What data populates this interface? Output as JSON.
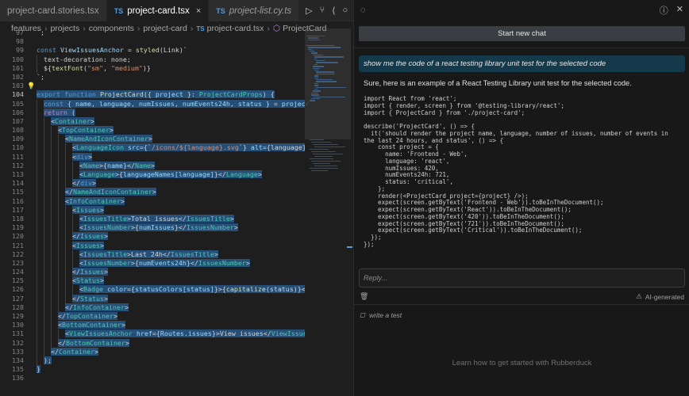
{
  "tabs": [
    {
      "label": "project-card.stories.tsx",
      "prefix": "",
      "active": false,
      "italic": false,
      "close": ""
    },
    {
      "label": "project-card.tsx",
      "prefix": "TS",
      "active": true,
      "italic": false,
      "close": "×"
    },
    {
      "label": "project-list.cy.ts",
      "prefix": "TS",
      "active": false,
      "italic": true,
      "close": ""
    }
  ],
  "breadcrumb": [
    {
      "label": "features",
      "icon": ""
    },
    {
      "label": "projects",
      "icon": ""
    },
    {
      "label": "components",
      "icon": ""
    },
    {
      "label": "project-card",
      "icon": ""
    },
    {
      "label": "project-card.tsx",
      "icon": "TS"
    },
    {
      "label": "ProjectCard",
      "icon": "symbol"
    }
  ],
  "editor_actions": [
    {
      "name": "run-icon",
      "glyph": "▷"
    },
    {
      "name": "source-control-icon",
      "glyph": "⑂"
    },
    {
      "name": "go-back-icon",
      "glyph": "⟨"
    },
    {
      "name": "circle-icon",
      "glyph": "○"
    },
    {
      "name": "go-forward-icon",
      "glyph": "⟩"
    },
    {
      "name": "github-icon",
      "glyph": "◉"
    },
    {
      "name": "split-editor-icon",
      "glyph": "▯"
    },
    {
      "name": "more-icon",
      "glyph": "…"
    }
  ],
  "code_lines": [
    {
      "n": "97",
      "indent": 0,
      "sel": false,
      "tokens": [
        [
          "pl",
          "`;"
        ]
      ]
    },
    {
      "n": "98",
      "indent": 0,
      "sel": false,
      "tokens": []
    },
    {
      "n": "99",
      "indent": 0,
      "sel": false,
      "tokens": [
        [
          "kw",
          "const "
        ],
        [
          "var",
          "ViewIssuesAnchor"
        ],
        [
          "pl",
          " = "
        ],
        [
          "fn",
          "styled"
        ],
        [
          "pl",
          "(Link)`"
        ]
      ]
    },
    {
      "n": "100",
      "indent": 1,
      "sel": false,
      "tokens": [
        [
          "pl",
          "text-decoration: none;"
        ]
      ]
    },
    {
      "n": "101",
      "indent": 1,
      "sel": false,
      "tokens": [
        [
          "pl",
          "${"
        ],
        [
          "fn",
          "textFont"
        ],
        [
          "pl",
          "("
        ],
        [
          "str",
          "\"sm\""
        ],
        [
          "pl",
          ", "
        ],
        [
          "str",
          "\"medium\""
        ],
        [
          "pl",
          ")}"
        ]
      ]
    },
    {
      "n": "102",
      "indent": 0,
      "sel": false,
      "tokens": [
        [
          "pl",
          "`;"
        ]
      ]
    },
    {
      "n": "103",
      "indent": 0,
      "sel": false,
      "bulb": "💡",
      "tokens": []
    },
    {
      "n": "104",
      "indent": 0,
      "sel": true,
      "cur": true,
      "tokens": [
        [
          "kw",
          "export "
        ],
        [
          "kw",
          "function "
        ],
        [
          "fn",
          "ProjectCard"
        ],
        [
          "pl",
          "({ "
        ],
        [
          "var",
          "project"
        ],
        [
          "pl",
          " }: "
        ],
        [
          "tag",
          "ProjectCardProps"
        ],
        [
          "pl",
          ") {"
        ]
      ]
    },
    {
      "n": "105",
      "indent": 1,
      "sel": true,
      "tokens": [
        [
          "kw",
          "const "
        ],
        [
          "pl",
          "{ "
        ],
        [
          "var",
          "name"
        ],
        [
          "pl",
          ", "
        ],
        [
          "var",
          "language"
        ],
        [
          "pl",
          ", "
        ],
        [
          "var",
          "numIssues"
        ],
        [
          "pl",
          ", "
        ],
        [
          "var",
          "numEvents24h"
        ],
        [
          "pl",
          ", "
        ],
        [
          "var",
          "status"
        ],
        [
          "pl",
          " } = "
        ],
        [
          "var",
          "project"
        ],
        [
          "pl",
          ";"
        ]
      ]
    },
    {
      "n": "106",
      "indent": 1,
      "sel": true,
      "tokens": [
        [
          "kw2",
          "return "
        ],
        [
          "pl",
          "("
        ]
      ]
    },
    {
      "n": "107",
      "indent": 2,
      "sel": true,
      "tokens": [
        [
          "pl",
          "<"
        ],
        [
          "tag",
          "Container"
        ],
        [
          "pl",
          ">"
        ]
      ]
    },
    {
      "n": "108",
      "indent": 3,
      "sel": true,
      "tokens": [
        [
          "pl",
          "<"
        ],
        [
          "tag",
          "TopContainer"
        ],
        [
          "pl",
          ">"
        ]
      ]
    },
    {
      "n": "109",
      "indent": 4,
      "sel": true,
      "tokens": [
        [
          "pl",
          "<"
        ],
        [
          "tag",
          "NameAndIconContainer"
        ],
        [
          "pl",
          ">"
        ]
      ]
    },
    {
      "n": "110",
      "indent": 5,
      "sel": true,
      "tokens": [
        [
          "pl",
          "<"
        ],
        [
          "tag",
          "LanguageIcon"
        ],
        [
          "attr",
          " src"
        ],
        [
          "pl",
          "={`"
        ],
        [
          "str",
          "/icons/${language}.svg"
        ],
        [
          "pl",
          "`} "
        ],
        [
          "attr",
          "alt"
        ],
        [
          "pl",
          "={language} />"
        ]
      ]
    },
    {
      "n": "111",
      "indent": 5,
      "sel": true,
      "tokens": [
        [
          "pl",
          "<"
        ],
        [
          "kw",
          "div"
        ],
        [
          "pl",
          ">"
        ]
      ]
    },
    {
      "n": "112",
      "indent": 6,
      "sel": true,
      "tokens": [
        [
          "pl",
          "<"
        ],
        [
          "tag",
          "Name"
        ],
        [
          "pl",
          ">{"
        ],
        [
          "var",
          "name"
        ],
        [
          "pl",
          "}</"
        ],
        [
          "tag",
          "Name"
        ],
        [
          "pl",
          ">"
        ]
      ]
    },
    {
      "n": "113",
      "indent": 6,
      "sel": true,
      "tokens": [
        [
          "pl",
          "<"
        ],
        [
          "tag",
          "Language"
        ],
        [
          "pl",
          ">{"
        ],
        [
          "var",
          "languageNames[language]"
        ],
        [
          "pl",
          "}</"
        ],
        [
          "tag",
          "Language"
        ],
        [
          "pl",
          ">"
        ]
      ]
    },
    {
      "n": "114",
      "indent": 5,
      "sel": true,
      "tokens": [
        [
          "pl",
          "</"
        ],
        [
          "kw",
          "div"
        ],
        [
          "pl",
          ">"
        ]
      ]
    },
    {
      "n": "115",
      "indent": 4,
      "sel": true,
      "tokens": [
        [
          "pl",
          "</"
        ],
        [
          "tag",
          "NameAndIconContainer"
        ],
        [
          "pl",
          ">"
        ]
      ]
    },
    {
      "n": "116",
      "indent": 4,
      "sel": true,
      "tokens": [
        [
          "pl",
          "<"
        ],
        [
          "tag",
          "InfoContainer"
        ],
        [
          "pl",
          ">"
        ]
      ]
    },
    {
      "n": "117",
      "indent": 5,
      "sel": true,
      "tokens": [
        [
          "pl",
          "<"
        ],
        [
          "tag",
          "Issues"
        ],
        [
          "pl",
          ">"
        ]
      ]
    },
    {
      "n": "118",
      "indent": 6,
      "sel": true,
      "tokens": [
        [
          "pl",
          "<"
        ],
        [
          "tag",
          "IssuesTitle"
        ],
        [
          "pl",
          ">Total issues</"
        ],
        [
          "tag",
          "IssuesTitle"
        ],
        [
          "pl",
          ">"
        ]
      ]
    },
    {
      "n": "119",
      "indent": 6,
      "sel": true,
      "tokens": [
        [
          "pl",
          "<"
        ],
        [
          "tag",
          "IssuesNumber"
        ],
        [
          "pl",
          ">{"
        ],
        [
          "var",
          "numIssues"
        ],
        [
          "pl",
          "}</"
        ],
        [
          "tag",
          "IssuesNumber"
        ],
        [
          "pl",
          ">"
        ]
      ]
    },
    {
      "n": "120",
      "indent": 5,
      "sel": true,
      "tokens": [
        [
          "pl",
          "</"
        ],
        [
          "tag",
          "Issues"
        ],
        [
          "pl",
          ">"
        ]
      ]
    },
    {
      "n": "121",
      "indent": 5,
      "sel": true,
      "tokens": [
        [
          "pl",
          "<"
        ],
        [
          "tag",
          "Issues"
        ],
        [
          "pl",
          ">"
        ]
      ]
    },
    {
      "n": "122",
      "indent": 6,
      "sel": true,
      "tokens": [
        [
          "pl",
          "<"
        ],
        [
          "tag",
          "IssuesTitle"
        ],
        [
          "pl",
          ">Last 24h</"
        ],
        [
          "tag",
          "IssuesTitle"
        ],
        [
          "pl",
          ">"
        ]
      ]
    },
    {
      "n": "123",
      "indent": 6,
      "sel": true,
      "tokens": [
        [
          "pl",
          "<"
        ],
        [
          "tag",
          "IssuesNumber"
        ],
        [
          "pl",
          ">{"
        ],
        [
          "var",
          "numEvents24h"
        ],
        [
          "pl",
          "}</"
        ],
        [
          "tag",
          "IssuesNumber"
        ],
        [
          "pl",
          ">"
        ]
      ]
    },
    {
      "n": "124",
      "indent": 5,
      "sel": true,
      "tokens": [
        [
          "pl",
          "</"
        ],
        [
          "tag",
          "Issues"
        ],
        [
          "pl",
          ">"
        ]
      ]
    },
    {
      "n": "125",
      "indent": 5,
      "sel": true,
      "tokens": [
        [
          "pl",
          "<"
        ],
        [
          "tag",
          "Status"
        ],
        [
          "pl",
          ">"
        ]
      ]
    },
    {
      "n": "126",
      "indent": 6,
      "sel": true,
      "tokens": [
        [
          "pl",
          "<"
        ],
        [
          "tag",
          "Badge"
        ],
        [
          "attr",
          " color"
        ],
        [
          "pl",
          "={"
        ],
        [
          "var",
          "statusColors[status]"
        ],
        [
          "pl",
          "}>{"
        ],
        [
          "fn",
          "capitalize"
        ],
        [
          "pl",
          "(status)}</"
        ],
        [
          "tag",
          "Badge"
        ],
        [
          "pl",
          ">"
        ]
      ]
    },
    {
      "n": "127",
      "indent": 5,
      "sel": true,
      "tokens": [
        [
          "pl",
          "</"
        ],
        [
          "tag",
          "Status"
        ],
        [
          "pl",
          ">"
        ]
      ]
    },
    {
      "n": "128",
      "indent": 4,
      "sel": true,
      "tokens": [
        [
          "pl",
          "</"
        ],
        [
          "tag",
          "InfoContainer"
        ],
        [
          "pl",
          ">"
        ]
      ]
    },
    {
      "n": "129",
      "indent": 3,
      "sel": true,
      "tokens": [
        [
          "pl",
          "</"
        ],
        [
          "tag",
          "TopContainer"
        ],
        [
          "pl",
          ">"
        ]
      ]
    },
    {
      "n": "130",
      "indent": 3,
      "sel": true,
      "tokens": [
        [
          "pl",
          "<"
        ],
        [
          "tag",
          "BottomContainer"
        ],
        [
          "pl",
          ">"
        ]
      ]
    },
    {
      "n": "131",
      "indent": 4,
      "sel": true,
      "tokens": [
        [
          "pl",
          "<"
        ],
        [
          "tag",
          "ViewIssuesAnchor"
        ],
        [
          "attr",
          " href"
        ],
        [
          "pl",
          "={"
        ],
        [
          "var",
          "Routes.issues"
        ],
        [
          "pl",
          "}>View issues</"
        ],
        [
          "tag",
          "ViewIssuesAnchor"
        ],
        [
          "pl",
          ">"
        ]
      ]
    },
    {
      "n": "132",
      "indent": 3,
      "sel": true,
      "tokens": [
        [
          "pl",
          "</"
        ],
        [
          "tag",
          "BottomContainer"
        ],
        [
          "pl",
          ">"
        ]
      ]
    },
    {
      "n": "133",
      "indent": 2,
      "sel": true,
      "tokens": [
        [
          "pl",
          "</"
        ],
        [
          "tag",
          "Container"
        ],
        [
          "pl",
          ">"
        ]
      ]
    },
    {
      "n": "134",
      "indent": 1,
      "sel": true,
      "tokens": [
        [
          "pl",
          ");"
        ]
      ]
    },
    {
      "n": "135",
      "indent": 0,
      "sel": true,
      "tokens": [
        [
          "pl",
          "}"
        ]
      ]
    },
    {
      "n": "136",
      "indent": 0,
      "sel": false,
      "tokens": []
    }
  ],
  "chat": {
    "new_chat_label": "Start new chat",
    "user_message": "show me the code of a react testing library unit test for the selected code",
    "assistant_intro": "Sure, here is an example of a React Testing Library unit test for the selected code.",
    "code": [
      "import React from 'react';",
      "import { render, screen } from '@testing-library/react';",
      "import { ProjectCard } from './project-card';",
      "",
      "describe('ProjectCard', () => {",
      "  it('should render the project name, language, number of issues, number of events in",
      "the last 24 hours, and status', () => {",
      "    const project = {",
      "      name: 'Frontend - Web',",
      "      language: 'react',",
      "      numIssues: 420,",
      "      numEvents24h: 721,",
      "      status: 'critical',",
      "    };",
      "    render(<ProjectCard project={project} />);",
      "    expect(screen.getByText('Frontend - Web')).toBeInTheDocument();",
      "    expect(screen.getByText('React')).toBeInTheDocument();",
      "    expect(screen.getByText('420')).toBeInTheDocument();",
      "    expect(screen.getByText('721')).toBeInTheDocument();",
      "    expect(screen.getByText('Critical')).toBeInTheDocument();",
      "  });",
      "});"
    ],
    "reply_placeholder": "Reply...",
    "ai_generated_label": "AI-generated",
    "write_test_label": "write a test",
    "learn_more": "Learn how to get started with Rubberduck"
  },
  "colors": {
    "accent": "#4d9fe6",
    "selection": "#264f78",
    "user_message_bg": "#13394a",
    "button_bg": "#3a3d41"
  }
}
